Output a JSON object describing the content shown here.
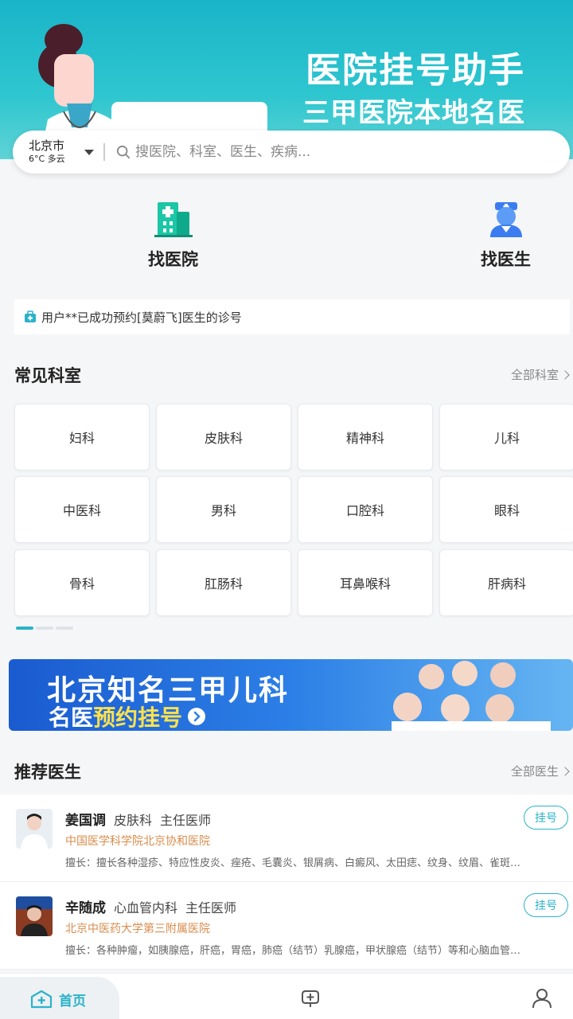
{
  "header": {
    "title": "医院挂号助手",
    "subtitle": "三甲医院本地名医",
    "bg_color": "#1ab4c9"
  },
  "search": {
    "city": "北京市",
    "weather": "6°C 多云",
    "placeholder": "搜医院、科室、医生、疾病..."
  },
  "quick_actions": [
    {
      "label": "找医院",
      "icon": "hospital-icon"
    },
    {
      "label": "找医生",
      "icon": "doctor-icon"
    }
  ],
  "notice": {
    "icon": "medical-kit-icon",
    "text": "用户**已成功预约[莫蔚飞]医生的诊号"
  },
  "departments": {
    "title": "常见科室",
    "more": "全部科室",
    "items": [
      "妇科",
      "皮肤科",
      "精神科",
      "儿科",
      "中医科",
      "男科",
      "口腔科",
      "眼科",
      "骨科",
      "肛肠科",
      "耳鼻喉科",
      "肝病科"
    ],
    "page_index": 0,
    "page_count": 3
  },
  "promo": {
    "title": "北京知名三甲儿科",
    "sub_prefix": "名医",
    "sub_highlight": "预约挂号"
  },
  "doctors": {
    "title": "推荐医生",
    "more": "全部医生",
    "items": [
      {
        "name": "姜国调",
        "dept": "皮肤科",
        "rank": "主任医师",
        "hospital": "中国医学科学院北京协和医院",
        "skill": "擅长：擅长各种湿疹、特应性皮炎、痤疮、毛囊炎、银屑病、白癜风、太田痣、纹身、纹眉、雀斑…",
        "button": "挂号"
      },
      {
        "name": "辛随成",
        "dept": "心血管内科",
        "rank": "主任医师",
        "hospital": "北京中医药大学第三附属医院",
        "skill": "擅长：各种肿瘤，如胰腺癌，肝癌，胃癌，肺癌（结节）乳腺癌，甲状腺癌（结节）等和心脑血管…",
        "button": "挂号"
      }
    ]
  },
  "bottom_nav": {
    "home_label": "首页",
    "accent": "#2bb3c9"
  }
}
